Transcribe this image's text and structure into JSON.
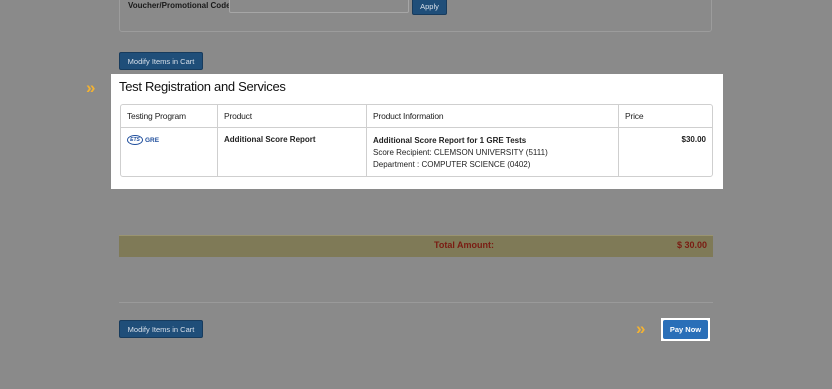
{
  "voucher": {
    "label": "Voucher/Promotional Code",
    "input_value": "",
    "apply_label": "Apply"
  },
  "cart": {
    "modify_label": "Modify Items in Cart",
    "section_title": "Test Registration and Services",
    "columns": [
      "Testing Program",
      "Product",
      "Product Information",
      "Price"
    ],
    "rows": [
      {
        "program_logo": {
          "ets": "ETS",
          "gre": "GRE"
        },
        "product": "Additional Score Report",
        "info_title": "Additional Score Report for 1 GRE Tests",
        "info_recipient": "Score Recipient: CLEMSON UNIVERSITY (5111)",
        "info_department": "Department : COMPUTER SCIENCE (0402)",
        "price": "$30.00"
      }
    ]
  },
  "total": {
    "label": "Total Amount:",
    "value": "$ 30.00"
  },
  "footer": {
    "modify_label": "Modify Items in Cart",
    "pay_label": "Pay Now",
    "chevron": "»"
  },
  "colors": {
    "accent_button": "#1f4e79",
    "pay_button": "#2a6fb8",
    "chevron": "#f2b233",
    "total_text": "#7a1c12"
  }
}
